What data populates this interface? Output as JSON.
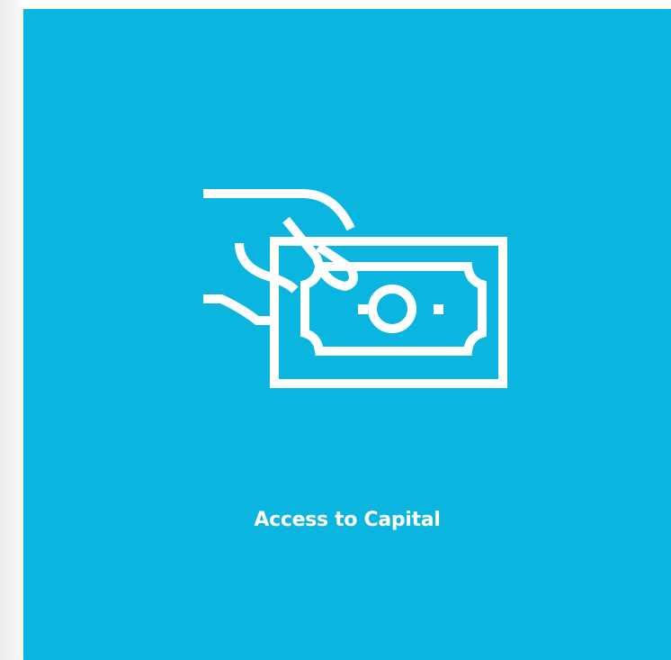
{
  "card": {
    "label": "Access to Capital",
    "icon": "hand-giving-money-icon",
    "background_color": "#0ab5df",
    "foreground_color": "#ffffff"
  }
}
